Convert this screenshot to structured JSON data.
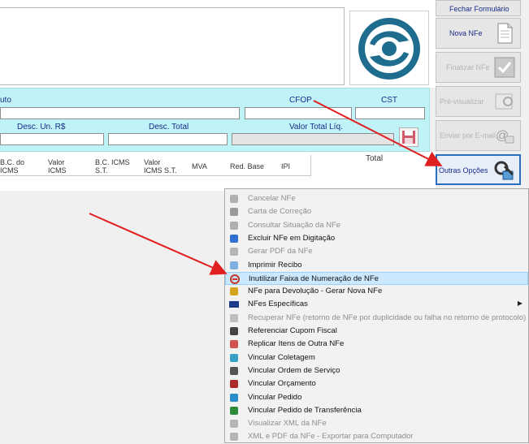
{
  "top_buttons": {
    "fechar": "Fechar Formulário",
    "nova": "Nova NFe",
    "finalizar": "Finalizar NFe",
    "pre": "Pré-visualizar",
    "enviar": "Enviar por E-mail",
    "outras": "Outras Opções"
  },
  "fields": {
    "produto": "uto",
    "cfop": "CFOP",
    "cst": "CST",
    "desc_un": "Desc. Un. R$",
    "desc_total": "Desc. Total",
    "valor_total": "Valor Total Líq."
  },
  "grid": {
    "headers": [
      "B.C. do\nICMS",
      "Valor\nICMS",
      "B.C. ICMS\nS.T.",
      "Valor\nICMS S.T.",
      "MVA",
      "Red. Base",
      "IPI"
    ],
    "total": "Total"
  },
  "menu": [
    {
      "label": "Cancelar NFe",
      "enabled": false,
      "icon": "cancel-icon"
    },
    {
      "label": "Carta de Correção",
      "enabled": false,
      "icon": "pen-icon"
    },
    {
      "label": "Consultar Situação da NFe",
      "enabled": false,
      "icon": "search-icon"
    },
    {
      "label": "Excluir NFe em Digitação",
      "enabled": true,
      "icon": "eraser-icon"
    },
    {
      "label": "Gerar PDF da NFe",
      "enabled": false,
      "icon": "pdf-icon"
    },
    {
      "label": "Imprimir Recibo",
      "enabled": true,
      "icon": "receipt-icon"
    },
    {
      "label": "Inutilizar Faixa de Numeração de NFe",
      "enabled": true,
      "icon": "block-icon",
      "highlighted": true
    },
    {
      "label": "NFe para Devolução - Gerar Nova NFe",
      "enabled": true,
      "icon": "return-icon"
    },
    {
      "label": "NFes Específicas",
      "enabled": true,
      "icon": "nfe-icon",
      "submenu": true
    },
    {
      "label": "Recuperar NFe (retorno de NFe por duplicidade ou falha no retorno de protocolo)",
      "enabled": false,
      "icon": "recover-icon"
    },
    {
      "label": "Referenciar Cupom Fiscal",
      "enabled": true,
      "icon": "coupon-icon"
    },
    {
      "label": "Replicar Itens de Outra NFe",
      "enabled": true,
      "icon": "replicate-icon"
    },
    {
      "label": "Vincular Coletagem",
      "enabled": true,
      "icon": "link-icon"
    },
    {
      "label": "Vincular Ordem de Serviço",
      "enabled": true,
      "icon": "service-icon"
    },
    {
      "label": "Vincular Orçamento",
      "enabled": true,
      "icon": "budget-icon"
    },
    {
      "label": "Vincular Pedido",
      "enabled": true,
      "icon": "order-icon"
    },
    {
      "label": "Vincular Pedido de Transferência",
      "enabled": true,
      "icon": "transfer-icon"
    },
    {
      "label": "Visualizar XML da NFe",
      "enabled": false,
      "icon": "xml-icon"
    },
    {
      "label": "XML e PDF da NFe - Exportar para Computador",
      "enabled": false,
      "icon": "export-icon"
    }
  ],
  "colors": {
    "panel": "#bff3f7",
    "label": "#1b2b8c",
    "highlight": "#cce8ff",
    "arrow": "#e02020"
  }
}
